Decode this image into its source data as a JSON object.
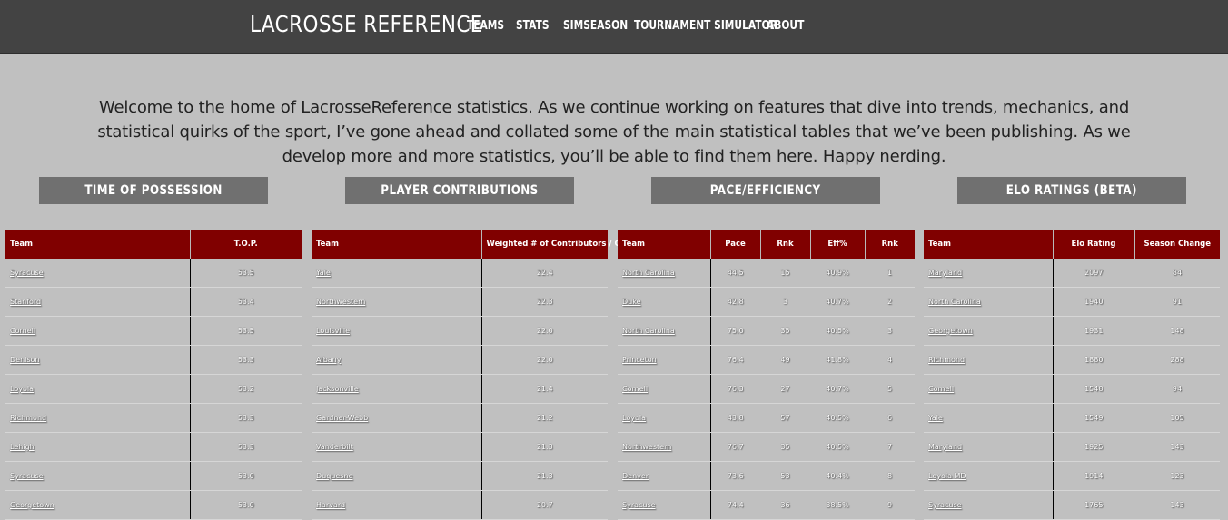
{
  "site": {
    "brand": "LACROSSE REFERENCE",
    "nav": [
      "TEAMS",
      "STATS",
      "SIMSEASON",
      "TOURNAMENT SIMULATOR",
      "ABOUT"
    ]
  },
  "intro": "Welcome to the home of LacrosseReference statistics. As we continue working on features that dive into trends, mechanics, and statistical quirks of the sport, I’ve gone ahead and collated some of the main statistical tables that we’ve been publishing.  As we develop more and more statistics, you’ll be able to find them here.  Happy nerding.",
  "sections": [
    "TIME OF POSSESSION",
    "PLAYER CONTRIBUTIONS",
    "PACE/EFFICIENCY",
    "ELO RATINGS (BETA)"
  ],
  "tables": {
    "top": {
      "headers": [
        "Team",
        "T.O.P."
      ],
      "rows": [
        [
          "Syracuse",
          "53.5"
        ],
        [
          "Stanford",
          "53.4"
        ],
        [
          "Cornell",
          "53.5"
        ],
        [
          "Denison",
          "53.3"
        ],
        [
          "Loyola",
          "53.2"
        ],
        [
          "Richmond",
          "53.3"
        ],
        [
          "Lehigh",
          "53.3"
        ],
        [
          "Syracuse",
          "53.0"
        ],
        [
          "Georgetown",
          "53.0"
        ]
      ]
    },
    "contrib": {
      "headers": [
        "Team",
        "Weighted # of Contributors / Gm"
      ],
      "rows": [
        [
          "Yale",
          "22.4"
        ],
        [
          "Northwestern",
          "22.3"
        ],
        [
          "Louisville",
          "22.0"
        ],
        [
          "Albany",
          "22.0"
        ],
        [
          "Jacksonville",
          "21.4"
        ],
        [
          "Gardner-Webb",
          "21.2"
        ],
        [
          "Vanderbilt",
          "21.3"
        ],
        [
          "Duquesne",
          "21.3"
        ],
        [
          "Harvard",
          "20.7"
        ]
      ]
    },
    "pace": {
      "headers": [
        "Team",
        "Pace",
        "Rnk",
        "Eff%",
        "Rnk"
      ],
      "rows": [
        [
          "North Carolina",
          "44.5",
          "15",
          "40.9%",
          "1"
        ],
        [
          "Duke",
          "42.8",
          "3",
          "40.7%",
          "2"
        ],
        [
          "North Carolina",
          "75.0",
          "35",
          "40.5%",
          "3"
        ],
        [
          "Princeton",
          "76.4",
          "49",
          "41.8%",
          "4"
        ],
        [
          "Cornell",
          "76.3",
          "27",
          "40.7%",
          "5"
        ],
        [
          "Loyola",
          "43.8",
          "57",
          "40.5%",
          "6"
        ],
        [
          "Northwestern",
          "76.7",
          "35",
          "40.5%",
          "7"
        ],
        [
          "Denver",
          "73.6",
          "53",
          "40.4%",
          "8"
        ],
        [
          "Syracuse",
          "74.4",
          "36",
          "38.5%",
          "9"
        ]
      ]
    },
    "elo": {
      "headers": [
        "Team",
        "Elo Rating",
        "Season Change"
      ],
      "rows": [
        [
          "Maryland",
          "2097",
          "84"
        ],
        [
          "North Carolina",
          "1940",
          "91"
        ],
        [
          "Georgetown",
          "1931",
          "148"
        ],
        [
          "Richmond",
          "1880",
          "288"
        ],
        [
          "Cornell",
          "1548",
          "94"
        ],
        [
          "Yale",
          "1549",
          "105"
        ],
        [
          "Maryland",
          "1925",
          "143"
        ],
        [
          "Loyola MD",
          "1914",
          "123"
        ],
        [
          "Syracuse",
          "1765",
          "143"
        ]
      ]
    }
  }
}
